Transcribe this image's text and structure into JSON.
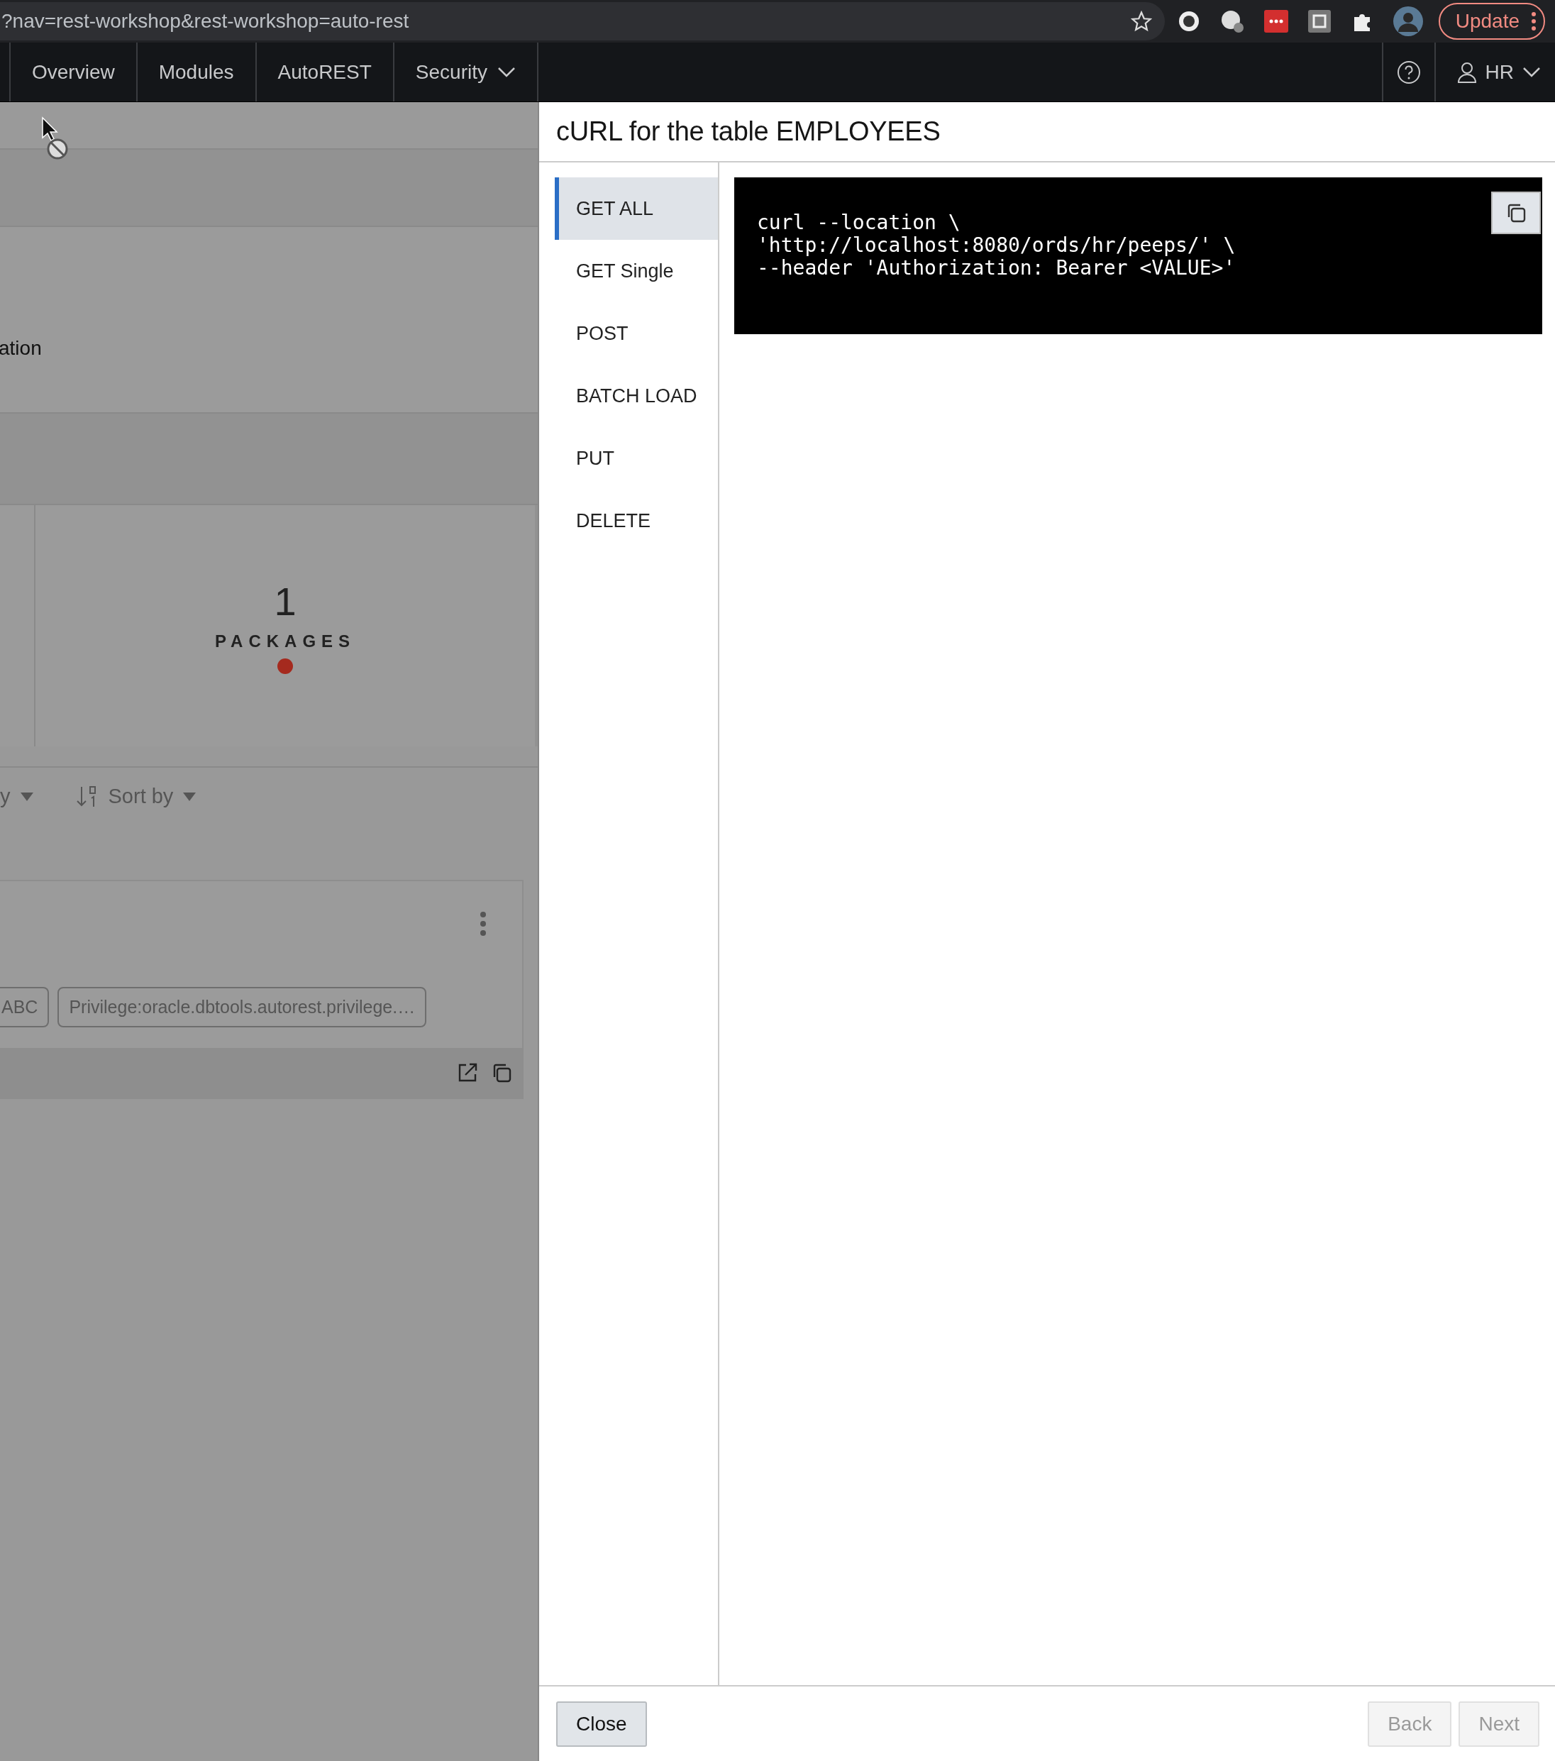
{
  "browser": {
    "url": "?nav=rest-workshop&rest-workshop=auto-rest",
    "update_button": "Update"
  },
  "nav": {
    "tabs": [
      {
        "label": "Overview"
      },
      {
        "label": "Modules"
      },
      {
        "label": "AutoREST"
      },
      {
        "label": "Security",
        "kind": "menu"
      }
    ],
    "user": "HR"
  },
  "background": {
    "partial_text": "ation",
    "stat": {
      "value": "1",
      "label": "PACKAGES"
    },
    "filter_partial": "y",
    "sort_label": "Sort by",
    "chips": [
      "ABC",
      "Privilege:oracle.dbtools.autorest.privilege.…"
    ]
  },
  "dialog": {
    "title": "cURL for the table EMPLOYEES",
    "methods": [
      {
        "label": "GET ALL",
        "selected": true
      },
      {
        "label": "GET Single",
        "selected": false
      },
      {
        "label": "POST",
        "selected": false
      },
      {
        "label": "BATCH LOAD",
        "selected": false
      },
      {
        "label": "PUT",
        "selected": false
      },
      {
        "label": "DELETE",
        "selected": false
      }
    ],
    "code": [
      "curl --location \\",
      "'http://localhost:8080/ords/hr/peeps/' \\",
      "--header 'Authorization: Bearer <VALUE>'"
    ],
    "buttons": [
      {
        "label": "Close",
        "disabled": false
      },
      {
        "label": "Back",
        "disabled": true
      },
      {
        "label": "Next",
        "disabled": true
      }
    ]
  }
}
